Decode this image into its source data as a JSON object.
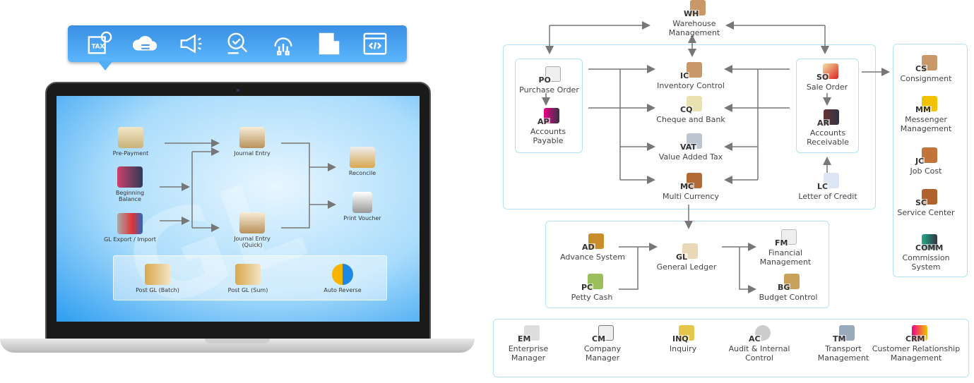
{
  "toolbar": {
    "icons": [
      "tax-icon",
      "cloud-sync-icon",
      "megaphone-icon",
      "search-check-icon",
      "gear-network-icon",
      "folder-icon",
      "code-window-icon"
    ],
    "tax_label": "TAX"
  },
  "screen": {
    "watermark": "GL",
    "nodes": {
      "prepayment": "Pre-Payment",
      "beginning_balance": "Beginning Balance",
      "gl_export_import": "GL Export / Import",
      "journal_entry": "Journal Entry",
      "journal_entry_quick": "Journal Entry (Quick)",
      "reconcile": "Reconcile",
      "print_voucher": "Print Voucher"
    },
    "post": {
      "batch": "Post GL (Batch)",
      "sum": "Post GL (Sum)",
      "auto_reverse": "Auto Reverse"
    }
  },
  "diagram": {
    "wh": {
      "code": "WH",
      "label": "Warehouse Management"
    },
    "po": {
      "code": "PO",
      "label": "Purchase Order"
    },
    "ap": {
      "code": "AP",
      "label": "Accounts Payable"
    },
    "ic": {
      "code": "IC",
      "label": "Inventory Control"
    },
    "cq": {
      "code": "CQ",
      "label": "Cheque and Bank"
    },
    "vat": {
      "code": "VAT",
      "label": "Value Added Tax"
    },
    "mc": {
      "code": "MC",
      "label": "Multi Currency"
    },
    "so": {
      "code": "SO",
      "label": "Sale Order"
    },
    "ar": {
      "code": "AR",
      "label": "Accounts Receivable"
    },
    "lc": {
      "code": "LC",
      "label": "Letter of Credit"
    },
    "side": [
      {
        "code": "CS",
        "label": "Consignment"
      },
      {
        "code": "MM",
        "label": "Messenger Management"
      },
      {
        "code": "JC",
        "label": "Job Cost"
      },
      {
        "code": "SC",
        "label": "Service Center"
      },
      {
        "code": "COMM",
        "label": "Commission System"
      }
    ],
    "ad": {
      "code": "AD",
      "label": "Advance System"
    },
    "pc": {
      "code": "PC",
      "label": "Petty Cash"
    },
    "gl": {
      "code": "GL",
      "label": "General Ledger"
    },
    "fm": {
      "code": "FM",
      "label": "Financial Management"
    },
    "bg": {
      "code": "BG",
      "label": "Budget Control"
    },
    "bottom": [
      {
        "code": "EM",
        "label": "Enterprise Manager"
      },
      {
        "code": "CM",
        "label": "Company Manager"
      },
      {
        "code": "INQ",
        "label": "Inquiry"
      },
      {
        "code": "AC",
        "label": "Audit & Internal Control"
      },
      {
        "code": "TM",
        "label": "Transport Management"
      },
      {
        "code": "CRM",
        "label": "Customer Relationship Management"
      }
    ]
  },
  "colors": {
    "toolbar": "#3a8fe4",
    "box_border": "#b5e3f5",
    "arrow": "#777777"
  }
}
